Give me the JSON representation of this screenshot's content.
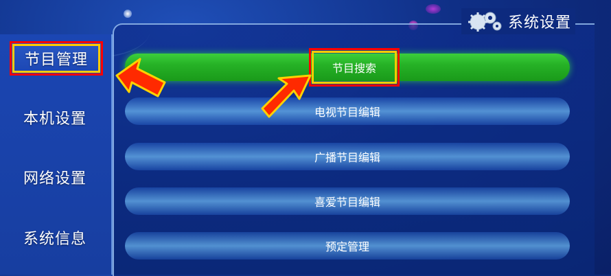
{
  "header": {
    "title": "系统设置"
  },
  "sidebar": {
    "items": [
      {
        "label": "节目管理",
        "active": true
      },
      {
        "label": "本机设置",
        "active": false
      },
      {
        "label": "网络设置",
        "active": false
      },
      {
        "label": "系统信息",
        "active": false
      }
    ]
  },
  "menu": {
    "items": [
      {
        "label": "节目搜索",
        "selected": true
      },
      {
        "label": "电视节目编辑",
        "selected": false
      },
      {
        "label": "广播节目编辑",
        "selected": false
      },
      {
        "label": "喜爱节目编辑",
        "selected": false
      },
      {
        "label": "预定管理",
        "selected": false
      }
    ]
  },
  "colors": {
    "background": "#0f2f86",
    "selected_row": "#26b226",
    "highlight_border": "#ff0000",
    "highlight_inner": "#ffcc00",
    "arrow": "#ff2a00"
  },
  "icons": {
    "title_icon": "gears-icon",
    "annotation_arrows": "arrow-icon"
  }
}
